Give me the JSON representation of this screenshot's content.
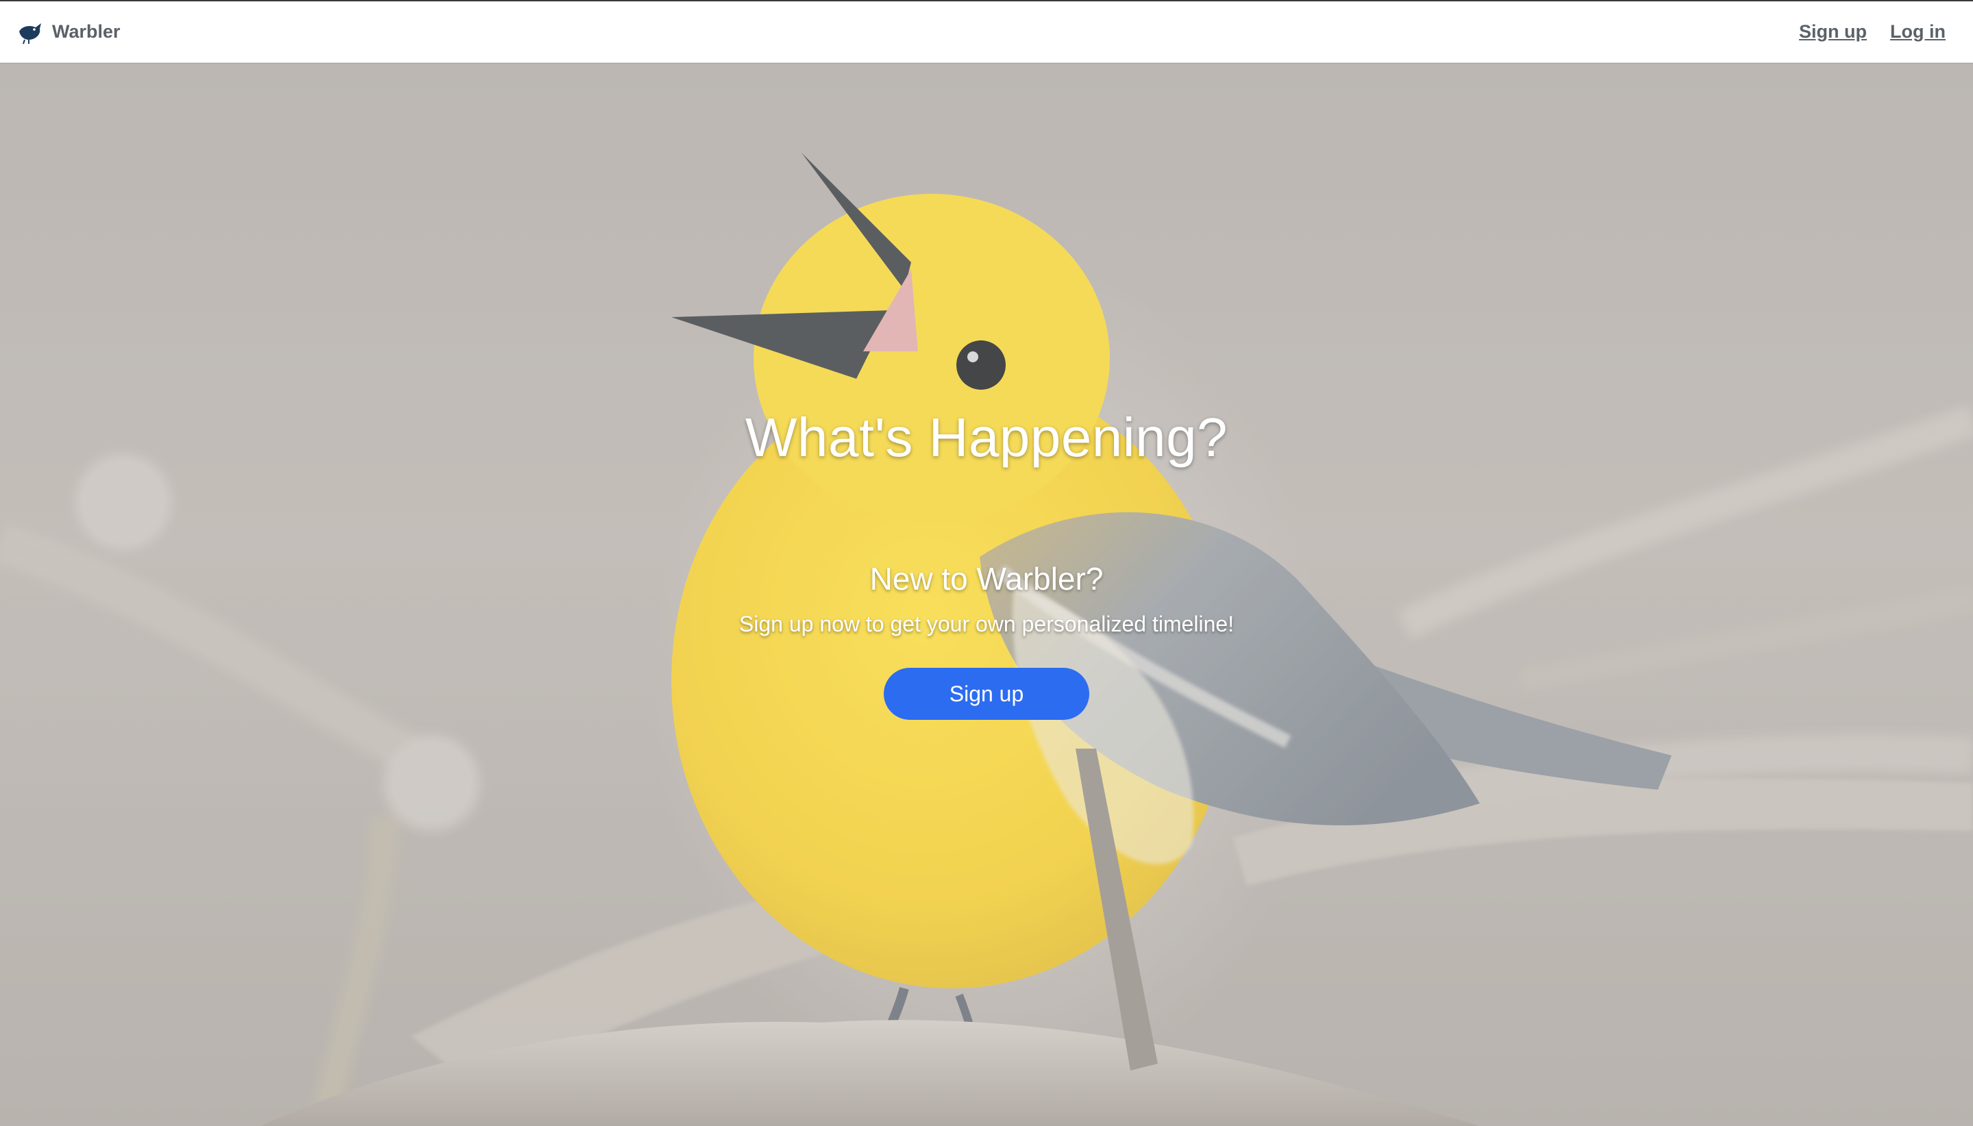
{
  "navbar": {
    "brand_name": "Warbler",
    "links": [
      "Sign up",
      "Log in"
    ]
  },
  "hero": {
    "headline": "What's Happening?",
    "subheading": "New to Warbler?",
    "tagline": "Sign up now to get your own personalized timeline!",
    "cta_label": "Sign up",
    "image": "yellow warbler perched on branch, singing"
  },
  "colors": {
    "cta": "#2c6cf0",
    "nav_text": "#5b6168",
    "bird_yellow": "#f2cf2a",
    "bird_grey": "#8e959c"
  }
}
